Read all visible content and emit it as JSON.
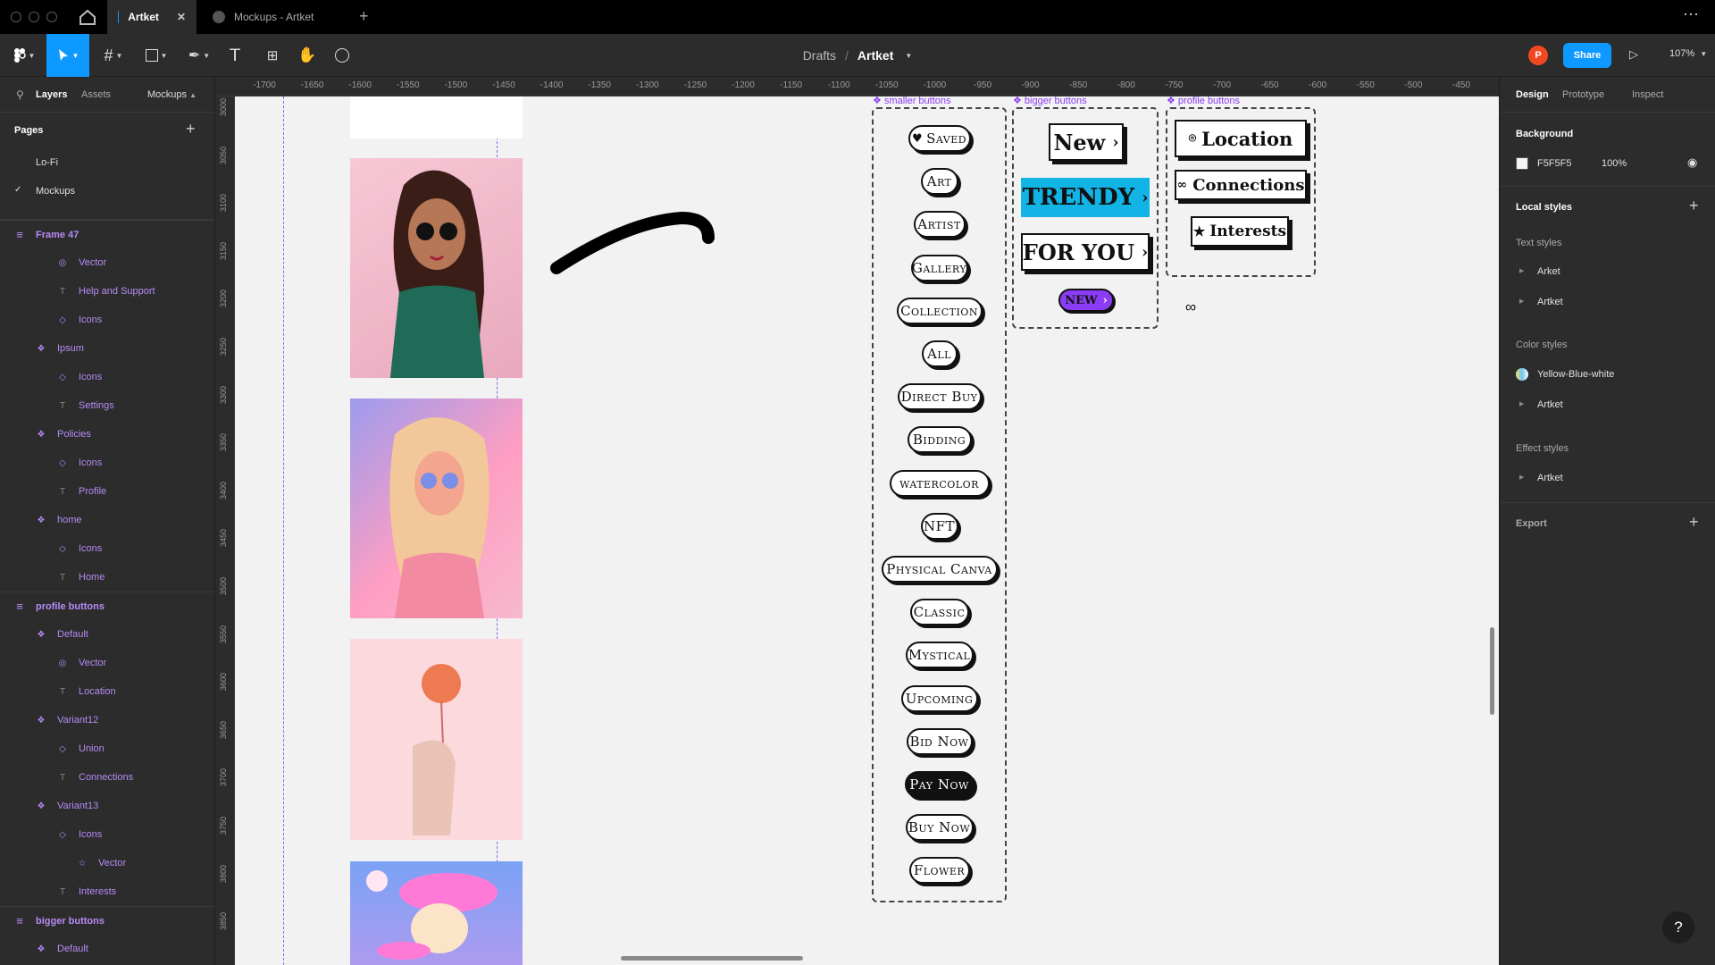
{
  "tabs": [
    {
      "label": "Artket",
      "active": true
    },
    {
      "label": "Mockups - Artket",
      "active": false
    }
  ],
  "toolbar": {
    "breadcrumb_parent": "Drafts",
    "breadcrumb_sep": "/",
    "file_name": "Artket",
    "avatar_letter": "P",
    "share_label": "Share",
    "zoom": "107%"
  },
  "left_panel": {
    "tab_layers": "Layers",
    "tab_assets": "Assets",
    "page_switch": "Mockups",
    "pages_heading": "Pages",
    "pages": [
      {
        "label": "Lo-Fi",
        "current": false
      },
      {
        "label": "Mockups",
        "current": true
      }
    ],
    "layers": [
      {
        "label": "Frame 47",
        "kind": "frame",
        "indent": 0
      },
      {
        "label": "Vector",
        "kind": "vector",
        "indent": 2
      },
      {
        "label": "Help and Support",
        "kind": "text",
        "indent": 2
      },
      {
        "label": "Icons",
        "kind": "instance",
        "indent": 2
      },
      {
        "label": "Ipsum",
        "kind": "component",
        "indent": 1
      },
      {
        "label": "Icons",
        "kind": "instance",
        "indent": 2
      },
      {
        "label": "Settings",
        "kind": "text",
        "indent": 2
      },
      {
        "label": "Policies",
        "kind": "component",
        "indent": 1
      },
      {
        "label": "Icons",
        "kind": "instance",
        "indent": 2
      },
      {
        "label": "Profile",
        "kind": "text",
        "indent": 2
      },
      {
        "label": "home",
        "kind": "component",
        "indent": 1
      },
      {
        "label": "Icons",
        "kind": "instance",
        "indent": 2
      },
      {
        "label": "Home",
        "kind": "text",
        "indent": 2
      },
      {
        "label": "profile buttons",
        "kind": "frame",
        "indent": 0
      },
      {
        "label": "Default",
        "kind": "component",
        "indent": 1
      },
      {
        "label": "Vector",
        "kind": "vector",
        "indent": 2
      },
      {
        "label": "Location",
        "kind": "text",
        "indent": 2
      },
      {
        "label": "Variant12",
        "kind": "component",
        "indent": 1
      },
      {
        "label": "Union",
        "kind": "instance",
        "indent": 2
      },
      {
        "label": "Connections",
        "kind": "text",
        "indent": 2
      },
      {
        "label": "Variant13",
        "kind": "component",
        "indent": 1
      },
      {
        "label": "Icons",
        "kind": "instance",
        "indent": 2
      },
      {
        "label": "Vector",
        "kind": "star",
        "indent": 3
      },
      {
        "label": "Interests",
        "kind": "text",
        "indent": 2
      },
      {
        "label": "bigger buttons",
        "kind": "frame",
        "indent": 0
      },
      {
        "label": "Default",
        "kind": "component",
        "indent": 1
      }
    ]
  },
  "ruler": {
    "x_ticks": [
      "-1700",
      "-1650",
      "-1600",
      "-1550",
      "-1500",
      "-1450",
      "-1400",
      "-1350",
      "-1300",
      "-1250",
      "-1200",
      "-1150",
      "-1100",
      "-1050",
      "-1000",
      "-950",
      "-900",
      "-850",
      "-800",
      "-750",
      "-700",
      "-650",
      "-600",
      "-550",
      "-500",
      "-450"
    ],
    "y_ticks": [
      "3000",
      "3050",
      "3100",
      "3150",
      "3200",
      "3250",
      "3300",
      "3350",
      "3400",
      "3450",
      "3500",
      "3550",
      "3600",
      "3650",
      "3700",
      "3750",
      "3800",
      "3850"
    ]
  },
  "canvas": {
    "smaller_label": "smaller buttons",
    "bigger_label": "bigger buttons",
    "profile_label": "profile buttons",
    "smaller_buttons": [
      "Saved",
      "Art",
      "Artist",
      "Gallery",
      "Collection",
      "All",
      "Direct Buy",
      "Bidding",
      "watercolor",
      "NFT",
      "Physical Canva",
      "Classic",
      "Mystical",
      "Upcoming",
      "Bid Now",
      "Pay Now",
      "Buy Now",
      "Flower"
    ],
    "bigger_buttons": [
      "New",
      "TRENDY",
      "FOR YOU",
      "NEW"
    ],
    "profile_buttons": [
      "Location",
      "Connections",
      "Interests"
    ]
  },
  "right_panel": {
    "tab_design": "Design",
    "tab_prototype": "Prototype",
    "tab_inspect": "Inspect",
    "background_heading": "Background",
    "background_hex": "F5F5F5",
    "background_opacity": "100%",
    "local_styles": "Local styles",
    "text_styles": "Text styles",
    "text_style_items": [
      "Arket",
      "Artket"
    ],
    "color_styles": "Color styles",
    "color_style_items": [
      "Yellow-Blue-white",
      "Artket"
    ],
    "effect_styles": "Effect styles",
    "effect_style_items": [
      "Artket"
    ],
    "export": "Export"
  },
  "colors": {
    "accent": "#0d99ff",
    "component": "#b68af5",
    "trendy": "#12b4e6",
    "new_pill": "#8a3df5",
    "avatar": "#f24822"
  }
}
